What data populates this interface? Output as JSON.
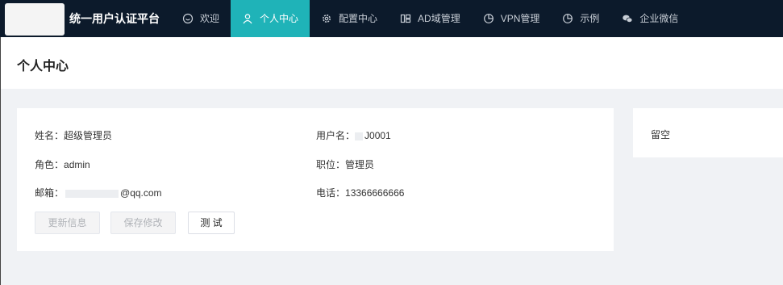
{
  "header": {
    "brand": "统一用户认证平台",
    "nav": [
      {
        "label": "欢迎",
        "icon": "smile-icon"
      },
      {
        "label": "个人中心",
        "icon": "user-icon",
        "active": true
      },
      {
        "label": "配置中心",
        "icon": "gear-icon"
      },
      {
        "label": "AD域管理",
        "icon": "grid-icon"
      },
      {
        "label": "VPN管理",
        "icon": "pie-chart-icon"
      },
      {
        "label": "示例",
        "icon": "pie-chart-icon"
      },
      {
        "label": "企业微信",
        "icon": "wechat-icon"
      }
    ],
    "accent_color": "#1fb3b8",
    "bar_color": "#0c1a2b"
  },
  "page": {
    "title": "个人中心"
  },
  "profile": {
    "name_label": "姓名：",
    "name_value": "超级管理员",
    "username_label": "用户名：",
    "username_value": "J0001",
    "role_label": "角色：",
    "role_value": "admin",
    "position_label": "职位：",
    "position_value": "管理员",
    "email_label": "邮箱：",
    "email_value": "@qq.com",
    "phone_label": "电话：",
    "phone_value": "13366666666"
  },
  "actions": {
    "update_label": "更新信息",
    "save_label": "保存修改",
    "test_label": "测 试"
  },
  "side": {
    "text": "留空"
  }
}
